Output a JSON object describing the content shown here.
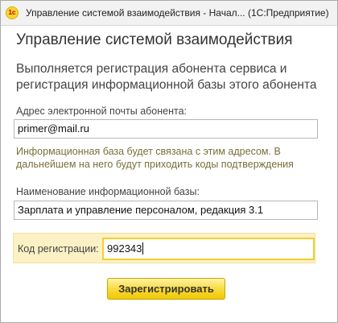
{
  "window": {
    "title": "Управление системой взаимодействия - Начал... (1С:Предприятие)",
    "app_icon_text": "1c"
  },
  "form": {
    "heading": "Управление системой взаимодействия",
    "lead": "Выполняется регистрация абонента сервиса и регистрация информационной базы этого абонента",
    "email": {
      "label": "Адрес электронной почты абонента:",
      "value": "primer@mail.ru"
    },
    "hint": "Информационная база будет связана с этим адресом. В дальнейшем на него будут приходить коды подтверждения",
    "infobase": {
      "label": "Наименование информационной базы:",
      "value": "Зарплата и управление персоналом, редакция 3.1"
    },
    "registration_code": {
      "label": "Код регистрации:",
      "value": "992343"
    },
    "register_button": "Зарегистрировать"
  },
  "colors": {
    "accent_yellow": "#f8d938",
    "highlight_bg": "#fbf1c4",
    "hint_text": "#7a6f3a"
  }
}
